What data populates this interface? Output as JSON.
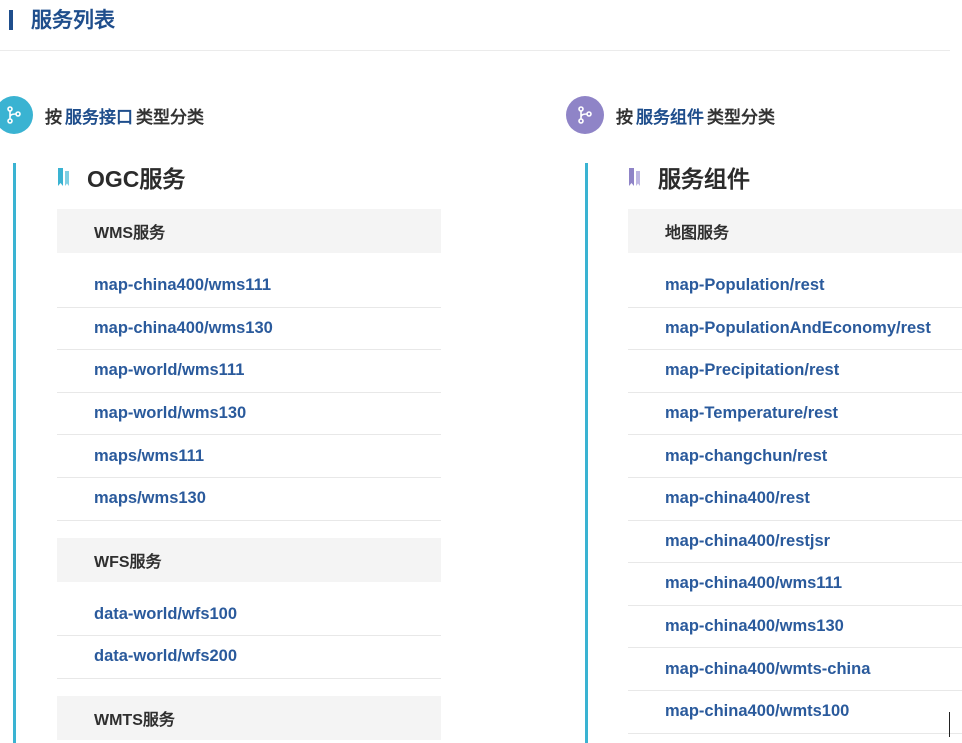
{
  "page": {
    "title": "服务列表"
  },
  "left": {
    "section": {
      "prefix": "按",
      "keyword": "服务接口",
      "suffix": "类型分类"
    },
    "group_title": "OGC服务",
    "categories": [
      {
        "name": "WMS服务",
        "items": [
          "map-china400/wms111",
          "map-china400/wms130",
          "map-world/wms111",
          "map-world/wms130",
          "maps/wms111",
          "maps/wms130"
        ]
      },
      {
        "name": "WFS服务",
        "items": [
          "data-world/wfs100",
          "data-world/wfs200"
        ]
      },
      {
        "name": "WMTS服务",
        "items": []
      }
    ]
  },
  "right": {
    "section": {
      "prefix": "按",
      "keyword": "服务组件",
      "suffix": "类型分类"
    },
    "group_title": "服务组件",
    "categories": [
      {
        "name": "地图服务",
        "items": [
          "map-Population/rest",
          "map-PopulationAndEconomy/rest",
          "map-Precipitation/rest",
          "map-Temperature/rest",
          "map-changchun/rest",
          "map-china400/rest",
          "map-china400/restjsr",
          "map-china400/wms111",
          "map-china400/wms130",
          "map-china400/wmts-china",
          "map-china400/wmts100"
        ]
      }
    ]
  },
  "colors": {
    "primary": "#1f4e8c",
    "link": "#2a5a9c",
    "teal": "#3ab3d2",
    "purple": "#8f84c7"
  },
  "icons": {
    "section": "branch-icon",
    "group": "bookmark-icon"
  }
}
